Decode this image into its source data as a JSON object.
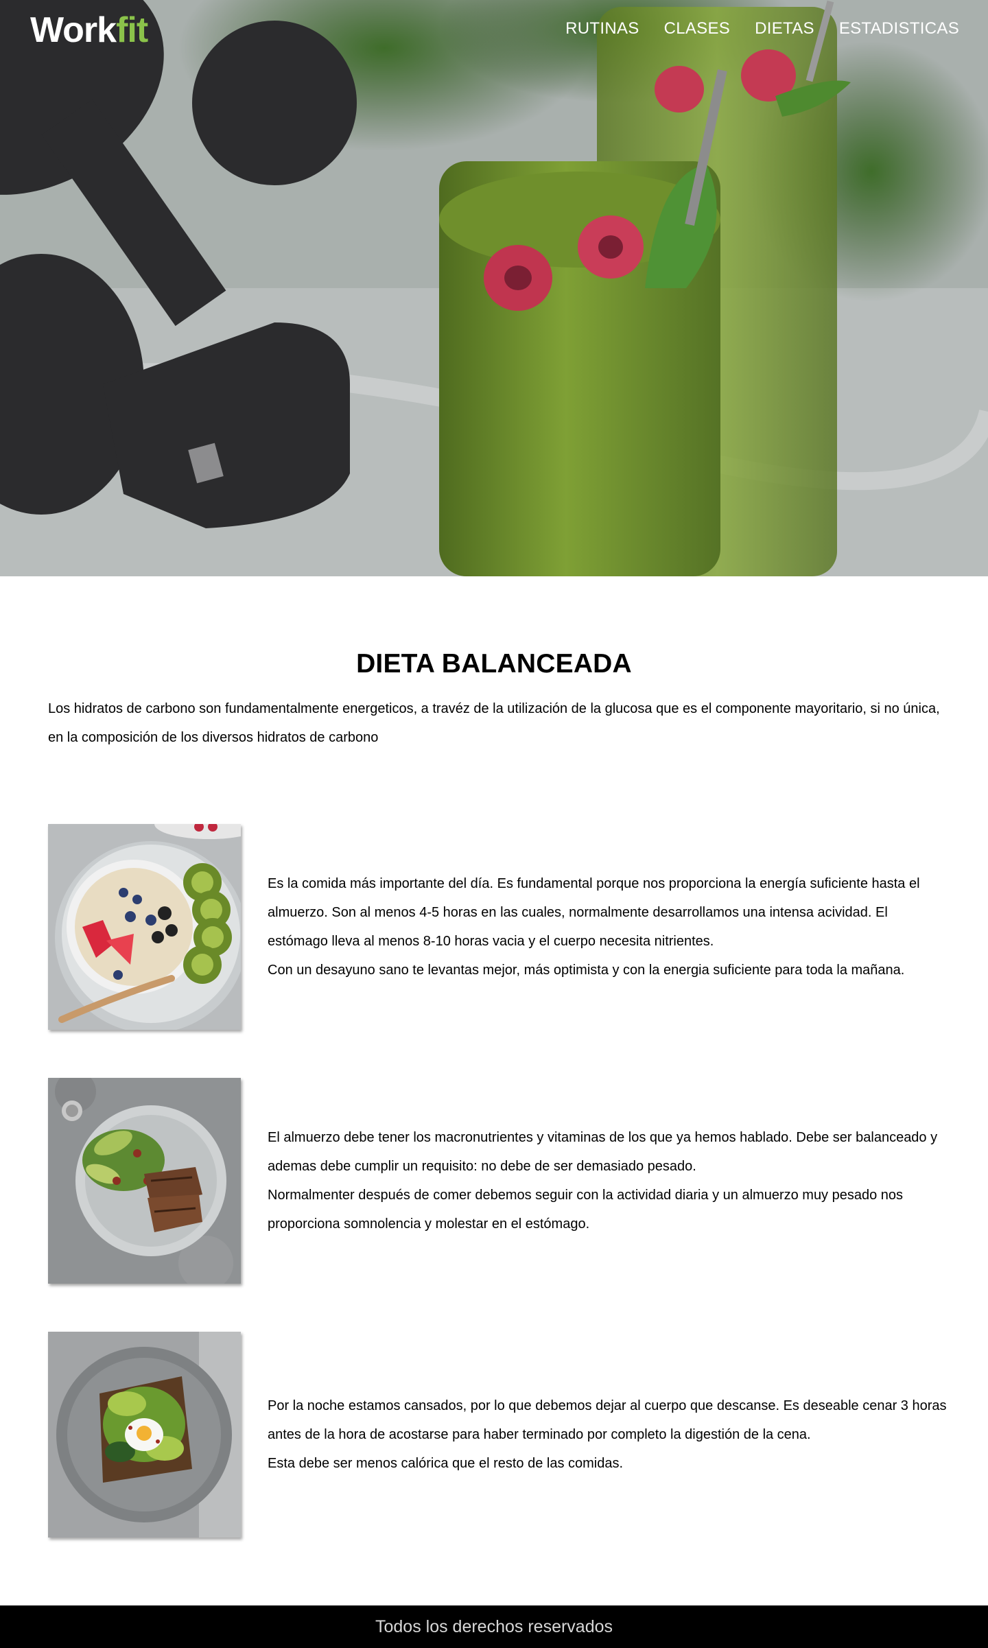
{
  "brand": {
    "logo_part1": "Work",
    "logo_part2": "fit"
  },
  "nav": {
    "items": [
      "RUTINAS",
      "CLASES",
      "DIETAS",
      "ESTADISTICAS"
    ]
  },
  "main": {
    "title": "DIETA BALANCEADA",
    "intro": "Los hidratos de carbono son fundamentalmente energeticos, a travéz de la utilización de la glucosa que es el componente mayoritario, si no única, en la composición de los diversos hidratos de carbono"
  },
  "meals": [
    {
      "image": "breakfast-oatmeal-bowl",
      "paragraphs": [
        "Es la comida más importante del día. Es fundamental porque nos proporciona la energía suficiente hasta el almuerzo. Son al menos 4-5 horas en las cuales, normalmente desarrollamos una intensa acividad. El estómago lleva al menos 8-10 horas vacia y el cuerpo necesita nitrientes.",
        "Con un desayuno sano te levantas mejor, más optimista y con la energia suficiente para toda la mañana."
      ]
    },
    {
      "image": "lunch-salmon-salad-plate",
      "paragraphs": [
        "El almuerzo debe tener los macronutrientes y vitaminas de los que ya hemos hablado. Debe ser balanceado y ademas debe cumplir un requisito: no debe de ser demasiado pesado.",
        "Normalmenter después de comer debemos seguir con la actividad diaria y un almuerzo muy pesado nos proporciona somnolencia y molestar en el estómago."
      ]
    },
    {
      "image": "dinner-avocado-egg-toast",
      "paragraphs": [
        "Por la noche estamos cansados, por lo que debemos dejar al cuerpo  que descanse. Es deseable cenar 3 horas antes de la hora de acostarse para haber terminado por completo la digestión de la cena.",
        "Esta debe ser menos calórica que el resto de las comidas."
      ]
    }
  ],
  "footer": {
    "text": "Todos los derechos reservados"
  },
  "colors": {
    "brand_accent": "#8bc34a",
    "footer_bg": "#000000",
    "nav_text": "#ffffff"
  }
}
